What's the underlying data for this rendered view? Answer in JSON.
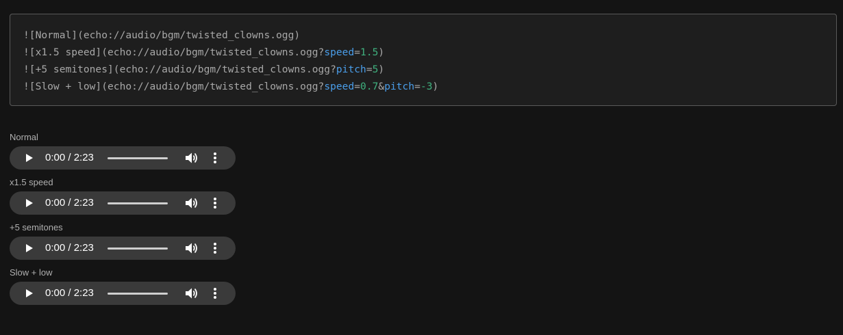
{
  "code_block": {
    "lines": [
      {
        "prefix": "![Normal](echo://audio/bgm/twisted_clowns.ogg)",
        "params": []
      },
      {
        "prefix": "![x1.5 speed](echo://audio/bgm/twisted_clowns.ogg?",
        "params": [
          {
            "key": "speed",
            "value": "1.5"
          }
        ],
        "suffix": ")"
      },
      {
        "prefix": "![+5 semitones](echo://audio/bgm/twisted_clowns.ogg?",
        "params": [
          {
            "key": "pitch",
            "value": "5"
          }
        ],
        "suffix": ")"
      },
      {
        "prefix": "![Slow + low](echo://audio/bgm/twisted_clowns.ogg?",
        "params": [
          {
            "key": "speed",
            "value": "0.7"
          },
          {
            "key": "pitch",
            "value": "-3"
          }
        ],
        "suffix": ")"
      }
    ]
  },
  "audio_players": [
    {
      "label": "Normal",
      "time": "0:00 / 2:23"
    },
    {
      "label": "x1.5 speed",
      "time": "0:00 / 2:23"
    },
    {
      "label": "+5 semitones",
      "time": "0:00 / 2:23"
    },
    {
      "label": "Slow + low",
      "time": "0:00 / 2:23"
    }
  ],
  "icons": {
    "play": "play-icon",
    "volume": "volume-icon",
    "menu": "more-vertical-icon"
  },
  "colors": {
    "background": "#141414",
    "code_background": "#1e1e1e",
    "code_text": "#a8a8a8",
    "param_key": "#4a9eea",
    "param_value": "#3fb27f",
    "player_background": "#3a3a3a"
  }
}
